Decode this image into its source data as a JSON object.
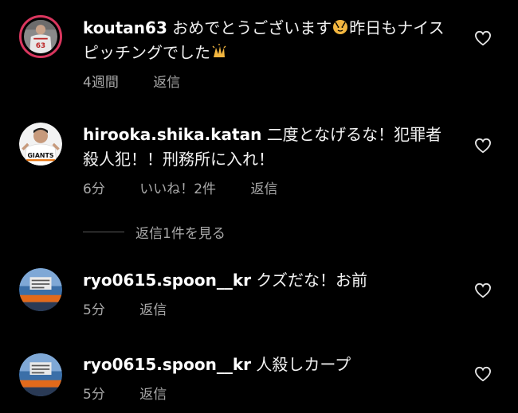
{
  "comments": [
    {
      "username": "koutan63",
      "text": "おめでとうございます",
      "emoji1": "🙌",
      "text2": "昨日もナイスピッチングでした",
      "emoji2": "👏",
      "time": "4週間",
      "likes": "",
      "reply_label": "返信",
      "avatar_icon": "avatar-baseball-jersey-63"
    },
    {
      "username": "hirooka.shika.katan",
      "text": "二度となげるな！犯罪者殺人犯！！刑務所に入れ！",
      "time": "6分",
      "likes": "いいね！2件",
      "reply_label": "返信",
      "avatar_icon": "avatar-giants-player"
    },
    {
      "username": "ryo0615.spoon__kr",
      "text": "クズだな！お前",
      "time": "5分",
      "likes": "",
      "reply_label": "返信",
      "avatar_icon": "avatar-stadium-banner"
    },
    {
      "username": "ryo0615.spoon__kr",
      "text": "人殺しカープ",
      "time": "5分",
      "likes": "",
      "reply_label": "返信",
      "avatar_icon": "avatar-stadium-banner"
    }
  ],
  "view_replies_label": "返信1件を見る",
  "colors": {
    "background": "#000000",
    "text": "#f2f2f2",
    "meta": "#a8a8a8",
    "story_ring": "#d9365e"
  },
  "icons": {
    "like": "heart-outline-icon"
  }
}
